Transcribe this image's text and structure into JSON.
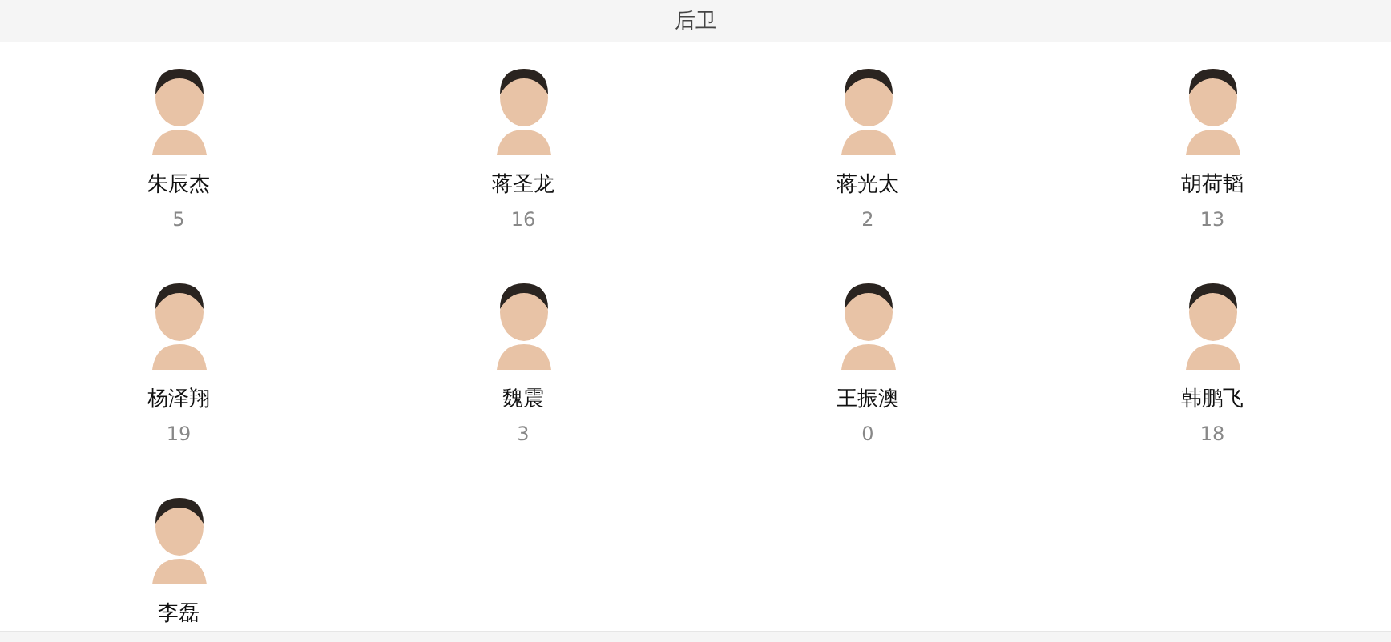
{
  "section": {
    "title": "后卫"
  },
  "players": [
    {
      "name": "朱辰杰",
      "number": "5"
    },
    {
      "name": "蒋圣龙",
      "number": "16"
    },
    {
      "name": "蒋光太",
      "number": "2"
    },
    {
      "name": "胡荷韬",
      "number": "13"
    },
    {
      "name": "杨泽翔",
      "number": "19"
    },
    {
      "name": "魏震",
      "number": "3"
    },
    {
      "name": "王振澳",
      "number": "0"
    },
    {
      "name": "韩鹏飞",
      "number": "18"
    },
    {
      "name": "李磊"
    }
  ]
}
